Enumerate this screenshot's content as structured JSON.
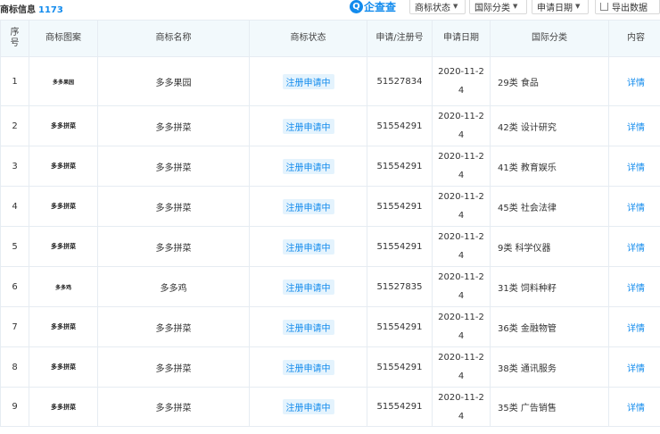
{
  "header": {
    "title": "商标信息",
    "count": "1173",
    "logo_text": "企查查",
    "filters": {
      "status_label": "商标状态",
      "class_label": "国际分类",
      "date_label": "申请日期",
      "export_label": "导出数据"
    }
  },
  "table": {
    "columns": {
      "index": "序号",
      "image": "商标图案",
      "name": "商标名称",
      "status": "商标状态",
      "reg_no": "申请/注册号",
      "date": "申请日期",
      "class": "国际分类",
      "content": "内容"
    },
    "rows": [
      {
        "index": "1",
        "image_text": "多多果园",
        "name": "多多果园",
        "status": "注册申请中",
        "reg_no": "51527834",
        "date": "2020-11-24",
        "class": "29类 食品",
        "content": "详情"
      },
      {
        "index": "2",
        "image_text": "多多拼菜",
        "name": "多多拼菜",
        "status": "注册申请中",
        "reg_no": "51554291",
        "date": "2020-11-24",
        "class": "42类 设计研究",
        "content": "详情"
      },
      {
        "index": "3",
        "image_text": "多多拼菜",
        "name": "多多拼菜",
        "status": "注册申请中",
        "reg_no": "51554291",
        "date": "2020-11-24",
        "class": "41类 教育娱乐",
        "content": "详情"
      },
      {
        "index": "4",
        "image_text": "多多拼菜",
        "name": "多多拼菜",
        "status": "注册申请中",
        "reg_no": "51554291",
        "date": "2020-11-24",
        "class": "45类 社会法律",
        "content": "详情"
      },
      {
        "index": "5",
        "image_text": "多多拼菜",
        "name": "多多拼菜",
        "status": "注册申请中",
        "reg_no": "51554291",
        "date": "2020-11-24",
        "class": "9类 科学仪器",
        "content": "详情"
      },
      {
        "index": "6",
        "image_text": "多多鸡",
        "name": "多多鸡",
        "status": "注册申请中",
        "reg_no": "51527835",
        "date": "2020-11-24",
        "class": "31类 饲料种籽",
        "content": "详情"
      },
      {
        "index": "7",
        "image_text": "多多拼菜",
        "name": "多多拼菜",
        "status": "注册申请中",
        "reg_no": "51554291",
        "date": "2020-11-24",
        "class": "36类 金融物管",
        "content": "详情"
      },
      {
        "index": "8",
        "image_text": "多多拼菜",
        "name": "多多拼菜",
        "status": "注册申请中",
        "reg_no": "51554291",
        "date": "2020-11-24",
        "class": "38类 通讯服务",
        "content": "详情"
      },
      {
        "index": "9",
        "image_text": "多多拼菜",
        "name": "多多拼菜",
        "status": "注册申请中",
        "reg_no": "51554291",
        "date": "2020-11-24",
        "class": "35类 广告销售",
        "content": "详情"
      }
    ]
  },
  "colors": {
    "accent": "#128bed",
    "header_bg": "#f2f9fc",
    "badge_bg": "#e4f3fd"
  }
}
